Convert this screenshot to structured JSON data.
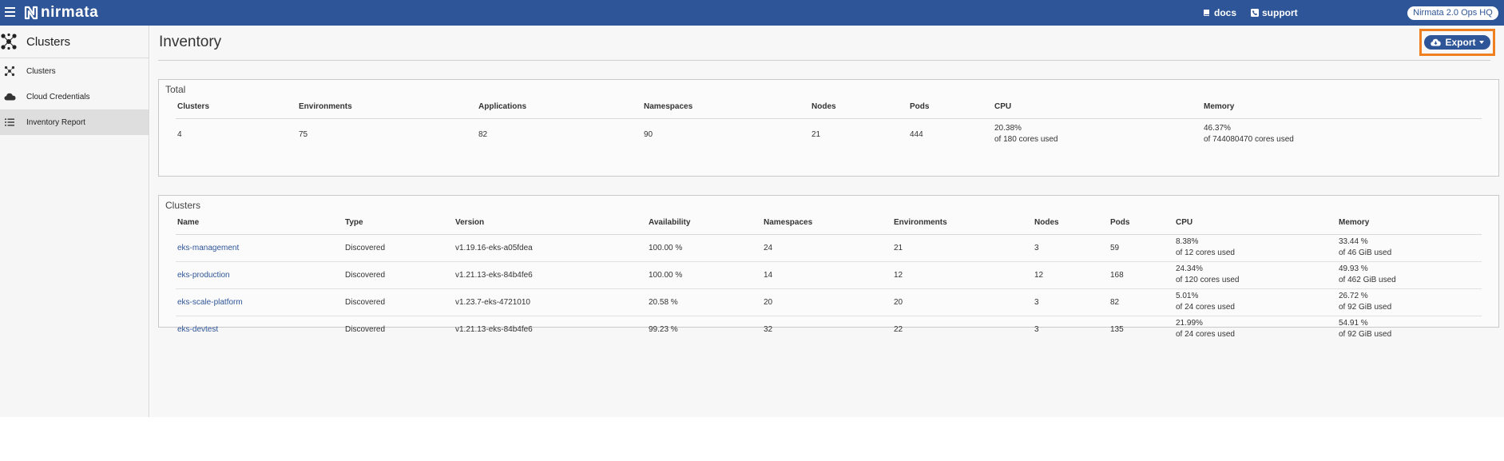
{
  "topbar": {
    "brand": "nirmata",
    "docs": "docs",
    "support": "support",
    "org": "Nirmata 2.0 Ops HQ"
  },
  "sidebar": {
    "title": "Clusters",
    "items": [
      {
        "label": "Clusters",
        "icon": "clusters-icon"
      },
      {
        "label": "Cloud Credentials",
        "icon": "cloud-icon"
      },
      {
        "label": "Inventory Report",
        "icon": "list-icon",
        "active": true
      }
    ]
  },
  "page": {
    "title": "Inventory",
    "export_label": "Export"
  },
  "total": {
    "title": "Total",
    "headers": [
      "Clusters",
      "Environments",
      "Applications",
      "Namespaces",
      "Nodes",
      "Pods",
      "CPU",
      "Memory"
    ],
    "values": {
      "clusters": "4",
      "environments": "75",
      "applications": "82",
      "namespaces": "90",
      "nodes": "21",
      "pods": "444",
      "cpu_pct": "20.38%",
      "cpu_sub": "of 180 cores used",
      "mem_pct": "46.37%",
      "mem_sub": "of 744080470 cores used"
    }
  },
  "clusters": {
    "title": "Clusters",
    "headers": [
      "Name",
      "Type",
      "Version",
      "Availability",
      "Namespaces",
      "Environments",
      "Nodes",
      "Pods",
      "CPU",
      "Memory"
    ],
    "rows": [
      {
        "name": "eks-management",
        "type": "Discovered",
        "version": "v1.19.16-eks-a05fdea",
        "availability": "100.00 %",
        "namespaces": "24",
        "environments": "21",
        "nodes": "3",
        "pods": "59",
        "cpu_pct": "8.38%",
        "cpu_sub": "of 12 cores used",
        "mem_pct": "33.44 %",
        "mem_sub": "of 46 GiB used"
      },
      {
        "name": "eks-production",
        "type": "Discovered",
        "version": "v1.21.13-eks-84b4fe6",
        "availability": "100.00 %",
        "namespaces": "14",
        "environments": "12",
        "nodes": "12",
        "pods": "168",
        "cpu_pct": "24.34%",
        "cpu_sub": "of 120 cores used",
        "mem_pct": "49.93 %",
        "mem_sub": "of 462 GiB used"
      },
      {
        "name": "eks-scale-platform",
        "type": "Discovered",
        "version": "v1.23.7-eks-4721010",
        "availability": "20.58 %",
        "namespaces": "20",
        "environments": "20",
        "nodes": "3",
        "pods": "82",
        "cpu_pct": "5.01%",
        "cpu_sub": "of 24 cores used",
        "mem_pct": "26.72 %",
        "mem_sub": "of 92 GiB used"
      },
      {
        "name": "eks-devtest",
        "type": "Discovered",
        "version": "v1.21.13-eks-84b4fe6",
        "availability": "99.23 %",
        "namespaces": "32",
        "environments": "22",
        "nodes": "3",
        "pods": "135",
        "cpu_pct": "21.99%",
        "cpu_sub": "of 24 cores used",
        "mem_pct": "54.91 %",
        "mem_sub": "of 92 GiB used"
      }
    ]
  },
  "colors": {
    "brand": "#2e5597",
    "highlight": "#f0801f"
  }
}
